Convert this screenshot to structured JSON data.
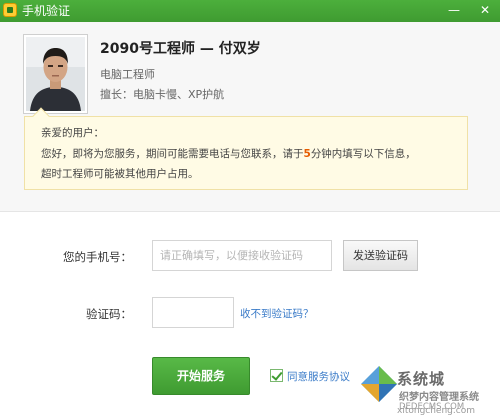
{
  "window": {
    "title": "手机验证",
    "minimize_glyph": "—",
    "close_glyph": "✕"
  },
  "engineer": {
    "name": "2090号工程师 — 付双岁",
    "role": "电脑工程师",
    "skills": "擅长：电脑卡慢、XP护航"
  },
  "notice": {
    "greeting": "亲爱的用户：",
    "line2_before": "您好，即将为您服务，期间可能需要电话与您联系，请于",
    "line2_highlight": "5",
    "line2_after": "分钟内填写以下信息，",
    "line3": "超时工程师可能被其他用户占用。"
  },
  "form": {
    "phone_label": "您的手机号：",
    "phone_placeholder": "请正确填写，以便接收验证码",
    "send_code_label": "发送验证码",
    "code_label": "验证码：",
    "code_value": "",
    "no_code_link": "收不到验证码？",
    "start_label": "开始服务",
    "agree_checked": true,
    "agree_label": "同意服务协议"
  },
  "watermark": {
    "brand": "系统城",
    "line1": "织梦内容管理系统",
    "line2": "DEDECMS.COM",
    "url": "xitongcheng.com"
  },
  "colors": {
    "titlebar": "#3f9b31",
    "primary_button": "#4caf3c",
    "link": "#3a7bc8",
    "highlight": "#e65c00"
  }
}
